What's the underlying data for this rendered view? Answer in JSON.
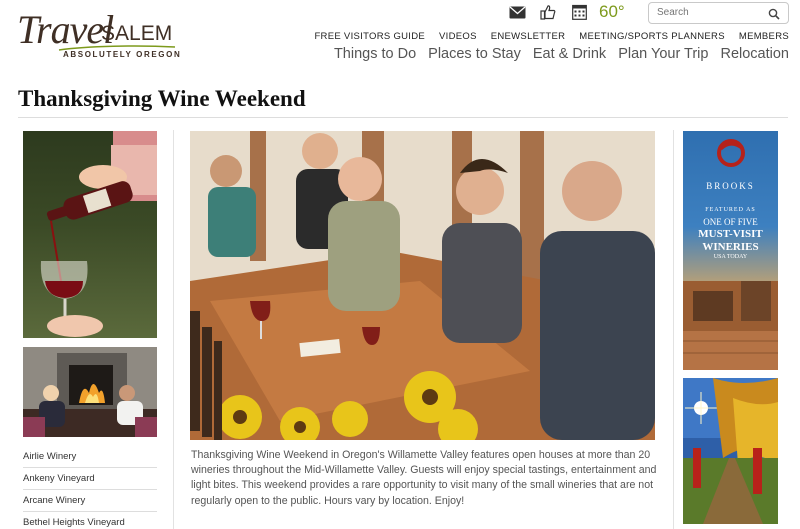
{
  "logo": {
    "travel": "Travel",
    "salem": "SALEM",
    "tagline": "ABSOLUTELY OREGON"
  },
  "utility": {
    "icons": [
      "mail-icon",
      "thumbs-up-icon",
      "calendar-icon"
    ],
    "temperature": "60°"
  },
  "search": {
    "placeholder": "Search"
  },
  "top_nav": [
    "FREE VISITORS GUIDE",
    "VIDEOS",
    "ENEWSLETTER",
    "MEETING/SPORTS PLANNERS",
    "MEMBERS"
  ],
  "main_nav": [
    "Things to Do",
    "Places to Stay",
    "Eat & Drink",
    "Plan Your Trip",
    "Relocation"
  ],
  "page": {
    "title": "Thanksgiving Wine Weekend",
    "description": "Thanksgiving Wine Weekend in Oregon's Willamette Valley features open houses at more than 20 wineries throughout the Mid-Willamette Valley. Guests will enjoy special tastings, entertainment and light bites. This weekend provides a rare opportunity to visit many of the small wineries that are not regularly open to the public. Hours vary by location. Enjoy!"
  },
  "winery_links": [
    "Airlie Winery",
    "Ankeny Vineyard",
    "Arcane Winery",
    "Bethel Heights Vineyard"
  ],
  "ad": {
    "brand": "BROOKS",
    "line1": "FEATURED AS",
    "line2": "ONE OF FIVE",
    "line3": "MUST-VISIT",
    "line4": "WINERIES",
    "line5": "USA TODAY"
  },
  "colors": {
    "accent_green": "#7d9a1c",
    "text_dark": "#3f2f25"
  }
}
